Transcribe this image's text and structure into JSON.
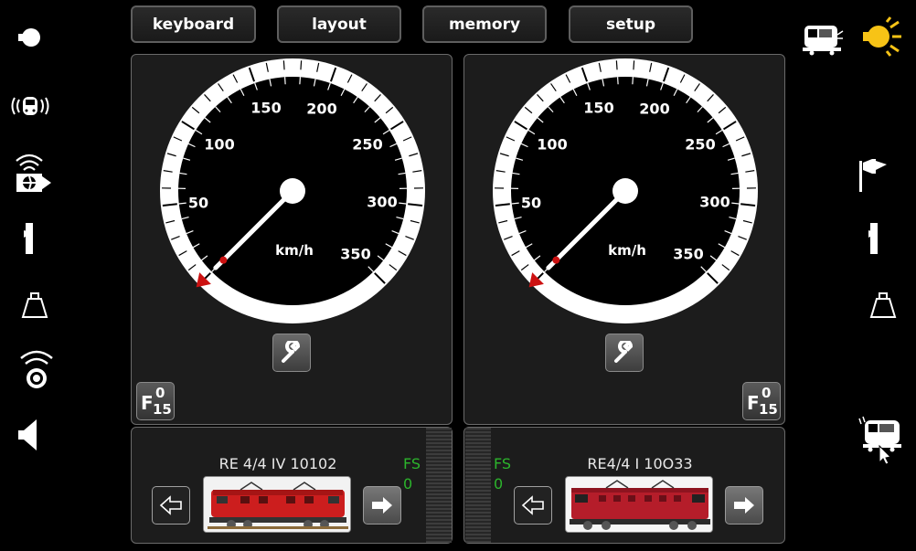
{
  "top_tabs": [
    "keyboard",
    "layout",
    "memory",
    "setup"
  ],
  "left_sidebar_icons": [
    "stop-icon",
    "locomotive-radio-icon",
    "wireless-handoff-icon",
    "signal-icon",
    "weight-icon",
    "broadcast-icon",
    "speaker-icon"
  ],
  "right_sidebar_icons": [
    "locomotive-list-icon",
    "light-icon",
    "flag-icon",
    "signal-icon",
    "weight-icon",
    "locomotive-select-icon"
  ],
  "speedometers": [
    {
      "ticks_labels": [
        "50",
        "100",
        "150",
        "200",
        "250",
        "300",
        "350"
      ],
      "unit": "km/h",
      "speed": 0,
      "function_button": {
        "letter": "F",
        "top": "0",
        "bottom": "15"
      }
    },
    {
      "ticks_labels": [
        "50",
        "100",
        "150",
        "200",
        "250",
        "300",
        "350"
      ],
      "unit": "km/h",
      "speed": 0,
      "function_button": {
        "letter": "F",
        "top": "0",
        "bottom": "15"
      }
    }
  ],
  "locos": [
    {
      "name": "RE 4/4 IV 10102",
      "fs_label": "FS",
      "fs_value": "0"
    },
    {
      "name": "RE4/4 I 10O33",
      "fs_label": "FS",
      "fs_value": "0"
    }
  ],
  "colors": {
    "accent_red": "#cc1111",
    "fs_green": "#2cb52c",
    "light_yellow": "#f7c316"
  }
}
